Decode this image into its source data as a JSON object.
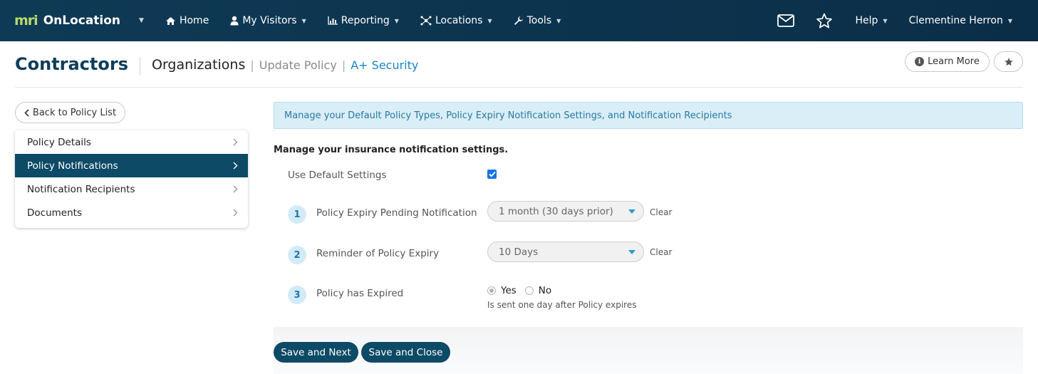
{
  "topnav": {
    "brand_mark": "mri",
    "brand_name": "OnLocation",
    "items": [
      {
        "label": "Home",
        "icon": "home-icon"
      },
      {
        "label": "My Visitors",
        "icon": "user-icon"
      },
      {
        "label": "Reporting",
        "icon": "bar-chart-icon"
      },
      {
        "label": "Locations",
        "icon": "network-icon"
      },
      {
        "label": "Tools",
        "icon": "wrench-icon"
      }
    ],
    "help_label": "Help",
    "user_name": "Clementine Herron"
  },
  "header": {
    "title": "Contractors",
    "crumb_org": "Organizations",
    "crumb_sep": "|",
    "crumb_update": "Update Policy",
    "crumb_security": "A+ Security",
    "learn_more": "Learn More"
  },
  "sidebar": {
    "back_label": "Back to Policy List",
    "items": [
      {
        "label": "Policy Details",
        "active": false
      },
      {
        "label": "Policy Notifications",
        "active": true
      },
      {
        "label": "Notification Recipients",
        "active": false
      },
      {
        "label": "Documents",
        "active": false
      }
    ]
  },
  "main": {
    "banner": "Manage your Default Policy Types, Policy Expiry Notification Settings, and Notification Recipients",
    "section_heading": "Manage your insurance notification settings.",
    "use_default_label": "Use Default Settings",
    "use_default_checked": true,
    "steps": [
      {
        "number": "1",
        "label": "Policy Expiry Pending Notification",
        "select_value": "1 month (30 days prior)",
        "clear": "Clear"
      },
      {
        "number": "2",
        "label": "Reminder of Policy Expiry",
        "select_value": "10 Days",
        "clear": "Clear"
      },
      {
        "number": "3",
        "label": "Policy has Expired",
        "yes": "Yes",
        "no": "No",
        "selected": "Yes",
        "help": "Is sent one day after Policy expires"
      }
    ],
    "save_next": "Save and Next",
    "save_close": "Save and Close"
  },
  "colors": {
    "nav_bg": "#0d3652",
    "brand_accent": "#b9d86a",
    "primary": "#0d4a66",
    "link": "#1787c4",
    "banner_bg": "#d9eef7"
  }
}
